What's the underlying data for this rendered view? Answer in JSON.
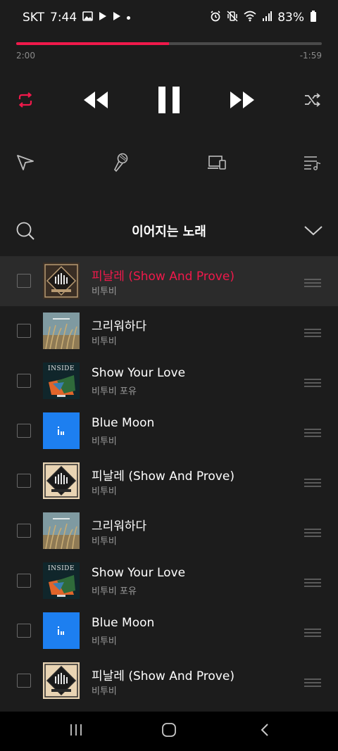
{
  "status_bar": {
    "carrier": "SKT",
    "time": "7:44",
    "battery": "83%",
    "left_icons": [
      "gallery-icon",
      "play-notification-icon",
      "play-notification-icon",
      "dot-icon"
    ],
    "right_icons": [
      "alarm-icon",
      "vibrate-icon",
      "wifi-icon",
      "signal-icon",
      "battery-icon"
    ]
  },
  "player": {
    "elapsed": "2:00",
    "remaining": "-1:59",
    "progress_fraction": 0.5,
    "accent_color": "#f0194b",
    "controls": [
      "repeat-icon",
      "rewind-icon",
      "pause-icon",
      "fast-forward-icon",
      "shuffle-icon"
    ],
    "utility": [
      "share-icon",
      "lyrics-mic-icon",
      "devices-icon",
      "playlist-icon"
    ]
  },
  "queue": {
    "title": "이어지는 노래",
    "items": [
      {
        "title": "피날레 (Show And Prove)",
        "artist": "비투비",
        "art": "finale",
        "active": true
      },
      {
        "title": "그리워하다",
        "artist": "비투비",
        "art": "missing",
        "active": false
      },
      {
        "title": "Show Your Love",
        "artist": "비투비 포유",
        "art": "inside",
        "active": false
      },
      {
        "title": "Blue Moon",
        "artist": "비투비",
        "art": "bluemoon",
        "active": false
      },
      {
        "title": "피날레 (Show And Prove)",
        "artist": "비투비",
        "art": "finale-light",
        "active": false
      },
      {
        "title": "그리워하다",
        "artist": "비투비",
        "art": "missing",
        "active": false
      },
      {
        "title": "Show Your Love",
        "artist": "비투비 포유",
        "art": "inside",
        "active": false
      },
      {
        "title": "Blue Moon",
        "artist": "비투비",
        "art": "bluemoon",
        "active": false
      },
      {
        "title": "피날레 (Show And Prove)",
        "artist": "비투비",
        "art": "finale-light",
        "active": false
      }
    ],
    "album_art_text": {
      "inside": "INSIDE"
    }
  },
  "nav_bar": {
    "buttons": [
      "recent-apps-icon",
      "home-icon",
      "back-icon"
    ]
  }
}
